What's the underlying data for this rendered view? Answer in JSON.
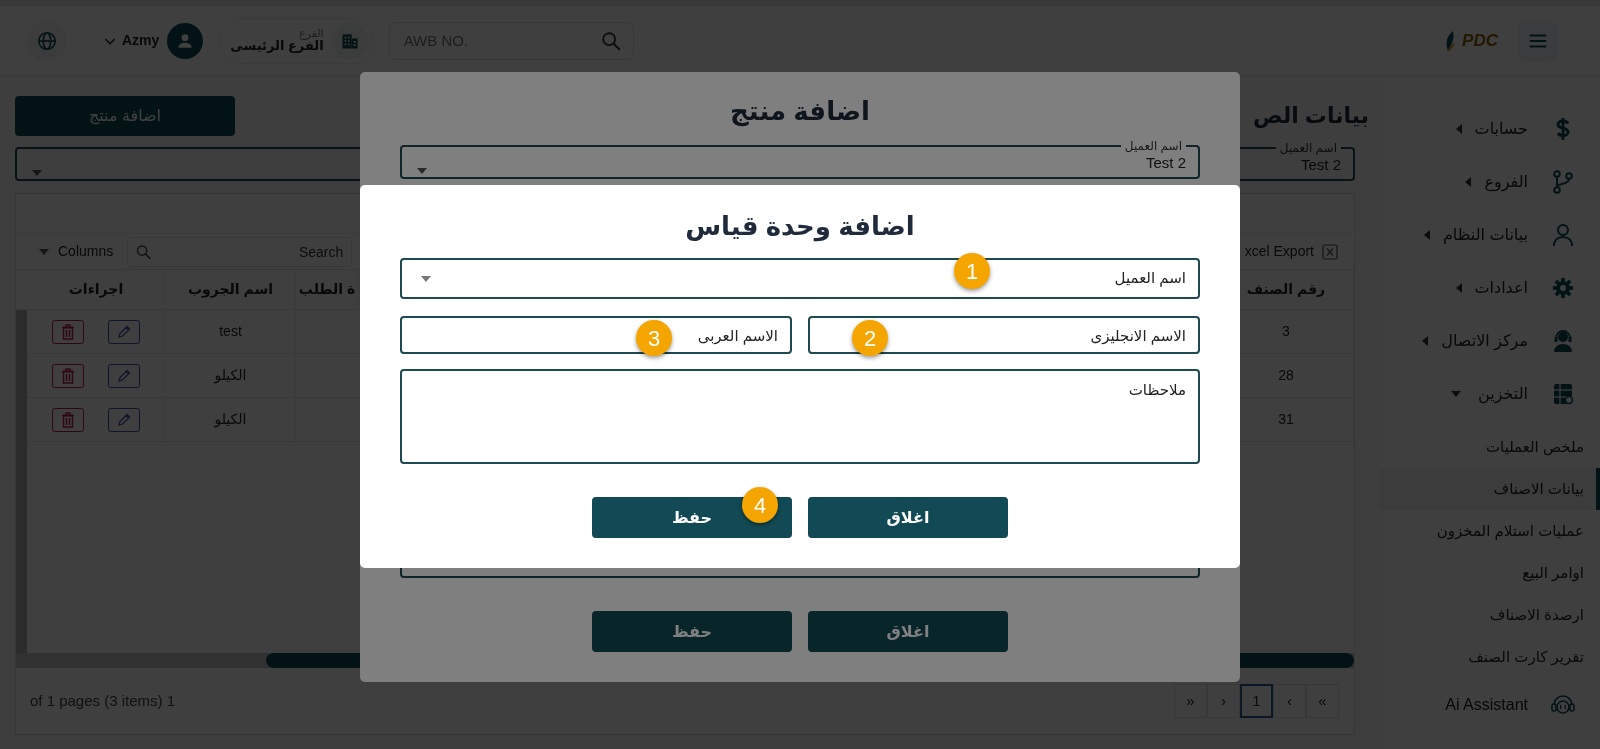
{
  "header": {
    "search": {
      "placeholder": "AWB NO."
    },
    "branch": {
      "label": "الفرع",
      "value": "الفرع الرئيسى"
    },
    "user": {
      "name": "Azmy"
    },
    "logo": "PDC"
  },
  "sidebar": {
    "items": [
      {
        "kind": "group",
        "label": "حسابات",
        "expanded": false
      },
      {
        "kind": "group",
        "label": "الفروع",
        "expanded": false
      },
      {
        "kind": "group",
        "label": "بيانات النظام",
        "expanded": false
      },
      {
        "kind": "group",
        "label": "اعدادات",
        "expanded": false
      },
      {
        "kind": "group",
        "label": "مركز الاتصال",
        "expanded": false
      },
      {
        "kind": "group",
        "label": "التخزين",
        "expanded": true,
        "children": [
          {
            "label": "ملخص العمليات",
            "selected": false
          },
          {
            "label": "بيانات الاصناف",
            "selected": true
          },
          {
            "label": "عمليات استلام المخزون",
            "selected": false
          },
          {
            "label": "اوامر البيع",
            "selected": false
          },
          {
            "label": "ارصدة الاصناف",
            "selected": false
          },
          {
            "label": "تقرير كارت الصنف",
            "selected": false
          }
        ]
      },
      {
        "kind": "link",
        "label": "Ai Assistant"
      }
    ]
  },
  "page": {
    "title": "بيانات الص",
    "add_button": "اضافة منتج",
    "customer_select": {
      "label": "اسم العميل",
      "value": "Test 2"
    }
  },
  "table": {
    "toolbar": {
      "columns_button": "Columns",
      "search_placeholder": "Search",
      "export_button": "xcel Export"
    },
    "columns": [
      {
        "kind": "item_number",
        "label": "رقم الصنف"
      },
      {
        "kind": "cut",
        "label": "ة الطلب"
      },
      {
        "kind": "group_name",
        "label": "اسم الجروب"
      },
      {
        "kind": "actions",
        "label": "اجراءات"
      }
    ],
    "rows": [
      {
        "group_name": "test",
        "item_number": "3"
      },
      {
        "group_name": "الكيلو",
        "item_number": "28"
      },
      {
        "group_name": "الكيلو",
        "item_number": "31"
      }
    ],
    "pager": {
      "summary": "of 1 pages (3 items) 1",
      "first": "«",
      "prev": "‹",
      "pages": [
        {
          "label": "1",
          "selected": true
        }
      ],
      "next": "›",
      "last": "»"
    }
  },
  "product_dialog": {
    "title": "اضافة منتج",
    "customer_select": {
      "label": "اسم العميل",
      "value": "Test 2"
    },
    "buttons": [
      "اغلاق",
      "حفظ"
    ]
  },
  "unit_dialog": {
    "title": "اضافة وحدة قياس",
    "customer_select": {
      "placeholder": "اسم العميل"
    },
    "english_name": {
      "placeholder": "الاسم الانجليزى"
    },
    "arabic_name": {
      "placeholder": "الاسم العربى"
    },
    "notes": {
      "placeholder": "ملاحظات"
    },
    "buttons": [
      "اغلاق",
      "حفظ"
    ]
  },
  "annotations": [
    {
      "label": "1"
    },
    {
      "label": "2"
    },
    {
      "label": "3"
    },
    {
      "label": "4"
    }
  ]
}
